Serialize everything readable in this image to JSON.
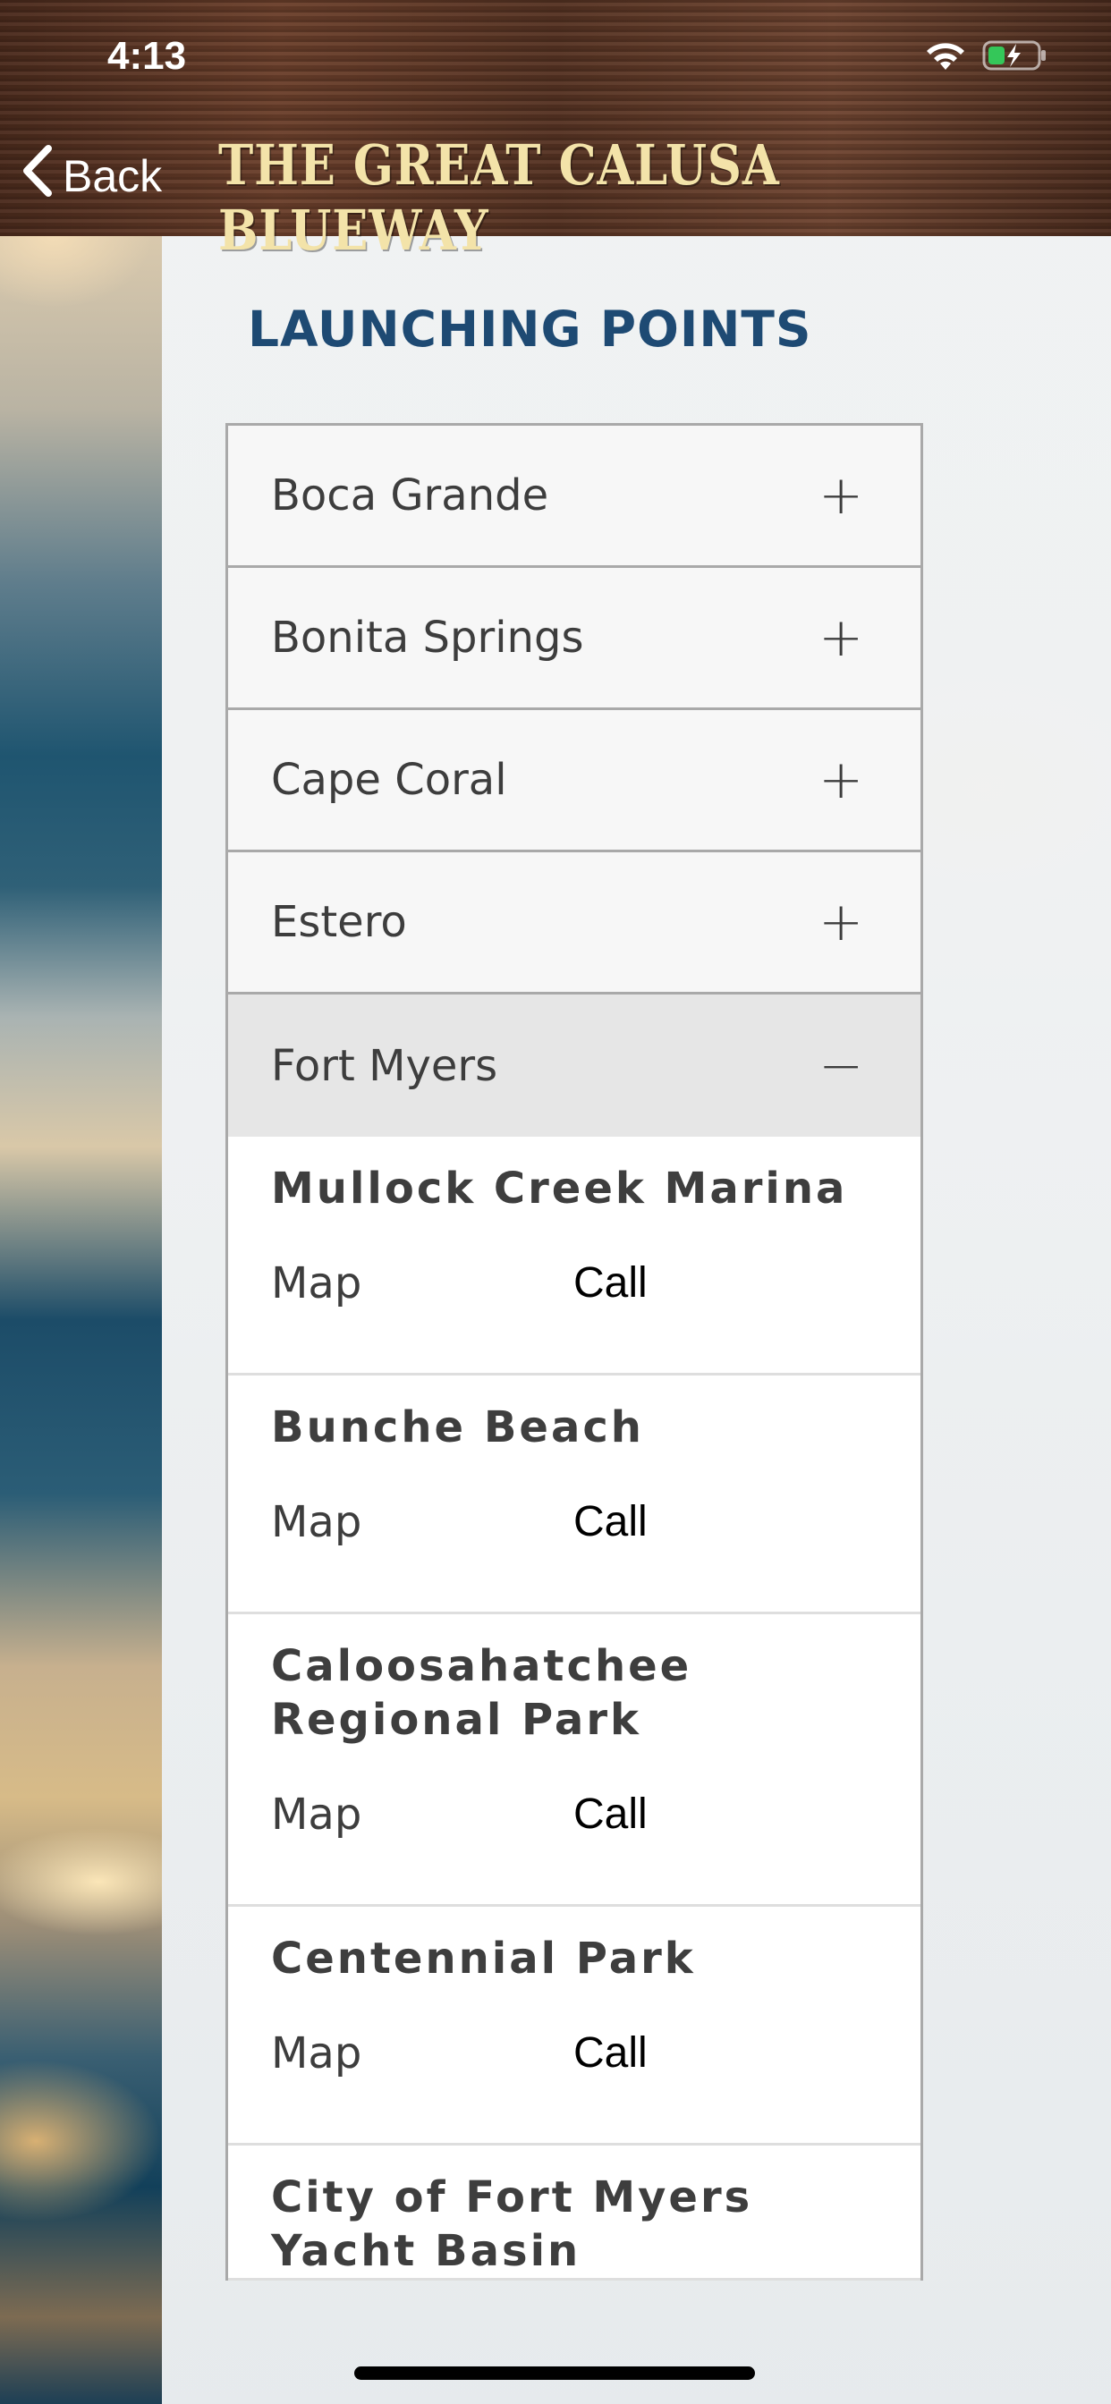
{
  "status_bar": {
    "time": "4:13",
    "icons": [
      "wifi-icon",
      "battery-charging-icon"
    ]
  },
  "header": {
    "back_label": "Back",
    "app_title": "THE GREAT CALUSA BLUEWAY",
    "back_icon": "chevron-left-icon"
  },
  "page": {
    "heading": "LAUNCHING POINTS"
  },
  "accordion": {
    "sections": [
      {
        "label": "Boca Grande",
        "sign": "+",
        "expanded": false
      },
      {
        "label": "Bonita Springs",
        "sign": "+",
        "expanded": false
      },
      {
        "label": "Cape Coral",
        "sign": "+",
        "expanded": false
      },
      {
        "label": "Estero",
        "sign": "+",
        "expanded": false
      },
      {
        "label": "Fort Myers",
        "sign": "−",
        "expanded": true
      }
    ],
    "fort_myers_locations": [
      {
        "name": "Mullock Creek Marina",
        "map": "Map",
        "call": "Call"
      },
      {
        "name": "Bunche Beach",
        "map": "Map",
        "call": "Call"
      },
      {
        "name": "Caloosahatchee Regional Park",
        "map": "Map",
        "call": "Call"
      },
      {
        "name": "Centennial Park",
        "map": "Map",
        "call": "Call"
      },
      {
        "name": "City of Fort Myers Yacht Basin",
        "map": "",
        "call": ""
      }
    ]
  },
  "colors": {
    "heading": "#1e4a73",
    "title": "#f3e3a9",
    "wood": "#5a3423",
    "battery": "#34c759"
  }
}
